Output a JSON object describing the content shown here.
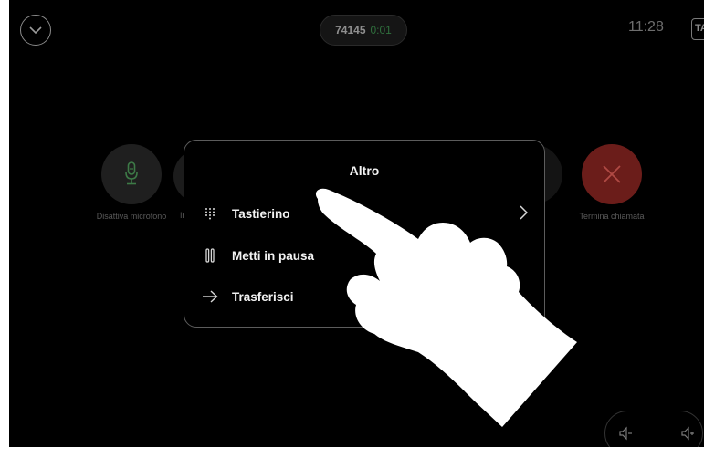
{
  "top_bar": {
    "call_number": "74145",
    "call_timer": "0:01",
    "clock": "11:28",
    "edge_badge": "TA"
  },
  "call_controls": {
    "mute": {
      "label": "Disattiva microfono",
      "icon": "microphone-icon"
    },
    "hidden": {
      "label": "Int",
      "icon": "unknown-icon"
    },
    "end_call": {
      "label": "Termina chiamata",
      "icon": "close-icon",
      "color": "#6b1d1a"
    }
  },
  "menu": {
    "title": "Altro",
    "items": [
      {
        "label": "Tastierino",
        "icon": "keypad-icon",
        "has_submenu": true
      },
      {
        "label": "Metti in pausa",
        "icon": "pause-icon"
      },
      {
        "label": "Trasferisci",
        "icon": "arrow-right-icon"
      }
    ]
  },
  "volume": {
    "down_icon": "volume-down-icon",
    "up_icon": "volume-up-icon"
  },
  "colors": {
    "background": "#000000",
    "end_call_red": "#6b1d1a",
    "timer_green": "#2f6f3d"
  }
}
